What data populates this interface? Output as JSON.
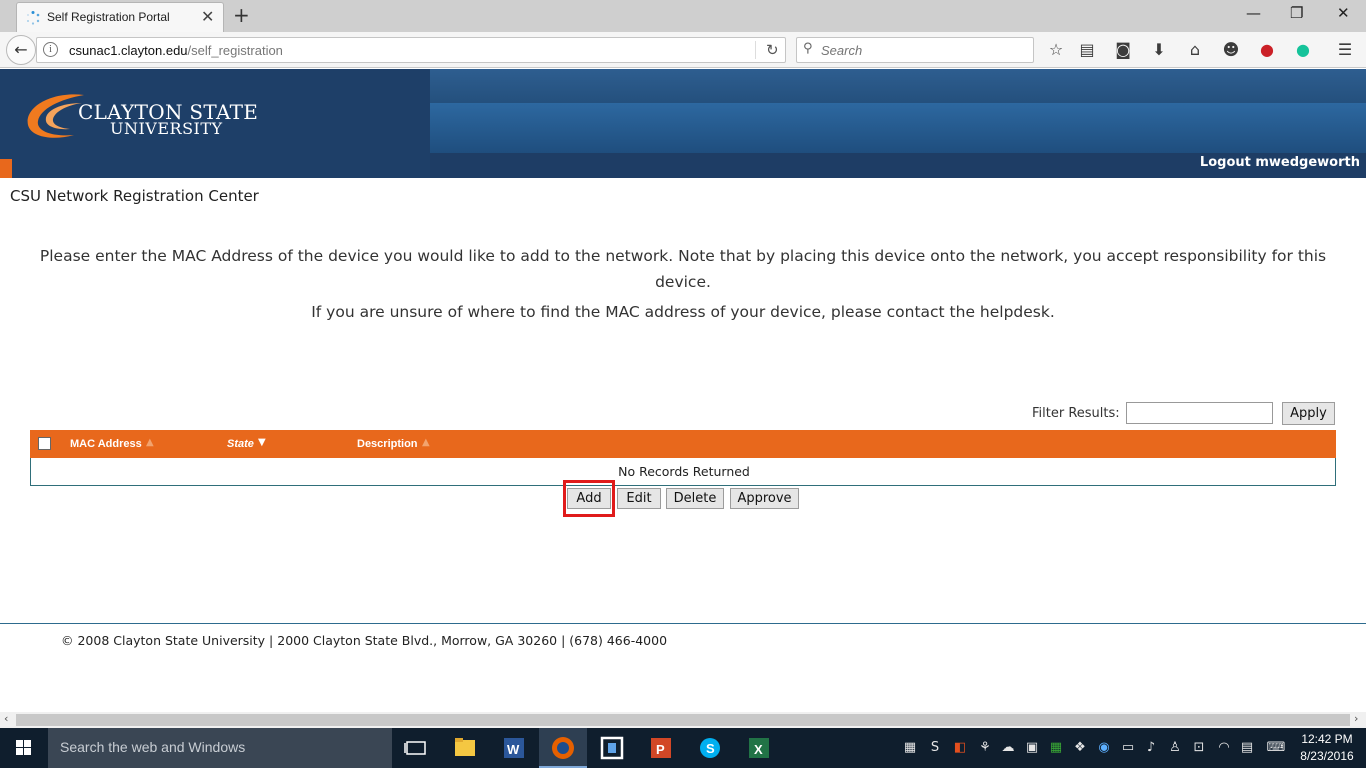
{
  "browser": {
    "tab_title": "Self Registration Portal",
    "url_host": "csunac1.clayton.edu",
    "url_path": "/self_registration",
    "search_placeholder": "Search"
  },
  "header": {
    "logo_line1": "CLAYTON STATE",
    "logo_line2": "UNIVERSITY",
    "logout": "Logout mwedgeworth"
  },
  "page": {
    "title": "CSU Network Registration Center",
    "intro": "Please enter the MAC Address of the device you would like to add to the network. Note that by placing this device onto the network, you accept responsibility for this device.",
    "help": "If you are unsure of where to find the MAC address of your device, please contact the helpdesk."
  },
  "filter": {
    "label": "Filter Results:",
    "value": "",
    "apply_label": "Apply"
  },
  "grid": {
    "columns": [
      "MAC Address",
      "State",
      "Description"
    ],
    "empty_message": "No Records Returned"
  },
  "actions": {
    "add": "Add",
    "edit": "Edit",
    "delete": "Delete",
    "approve": "Approve"
  },
  "footer": "© 2008 Clayton State University | 2000 Clayton State Blvd., Morrow, GA 30260 | (678) 466-4000",
  "taskbar": {
    "search_placeholder": "Search the web and Windows",
    "time": "12:42 PM",
    "date": "8/23/2016"
  },
  "colors": {
    "brand_navy": "#1e3d65",
    "brand_orange": "#e8681c",
    "highlight_red": "#e01b1b"
  }
}
